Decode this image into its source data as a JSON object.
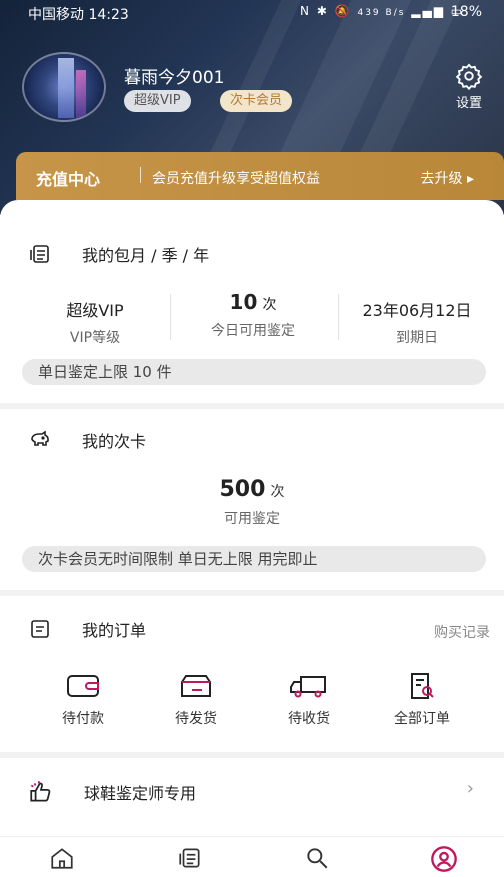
{
  "status_bar": {
    "carrier_time": "中国移动 14:23",
    "network_speed": "439 B/s",
    "battery": "18%"
  },
  "profile": {
    "username": "暮雨今夕001",
    "badges": [
      "超级VIP",
      "次卡会员"
    ],
    "settings_label": "设置"
  },
  "recharge": {
    "title": "充值中心",
    "description": "会员充值升级享受超值权益",
    "action": "去升级 ▸"
  },
  "subscription": {
    "title": "我的包月 / 季 / 年",
    "stats": [
      {
        "value": "超级VIP",
        "label": "VIP等级"
      },
      {
        "value": "10",
        "unit": "次",
        "label": "今日可用鉴定"
      },
      {
        "value": "23年06月12日",
        "label": "到期日"
      }
    ],
    "note": "单日鉴定上限 10 件"
  },
  "card_pass": {
    "title": "我的次卡",
    "value": "500",
    "unit": "次",
    "label": "可用鉴定",
    "note": "次卡会员无时间限制 单日无上限 用完即止"
  },
  "orders": {
    "title": "我的订单",
    "link": "购买记录",
    "items": [
      {
        "label": "待付款",
        "icon": "wallet-icon"
      },
      {
        "label": "待发货",
        "icon": "box-icon"
      },
      {
        "label": "待收货",
        "icon": "truck-icon"
      },
      {
        "label": "全部订单",
        "icon": "order-search-icon"
      }
    ]
  },
  "appraiser": {
    "title": "球鞋鉴定师专用",
    "arrow": "›"
  },
  "tabs": [
    {
      "icon": "home-icon"
    },
    {
      "icon": "list-icon"
    },
    {
      "icon": "search-icon"
    },
    {
      "icon": "profile-icon",
      "active": true
    }
  ],
  "colors": {
    "accent_gold": "#c69548",
    "active_tab": "#c0185f"
  }
}
